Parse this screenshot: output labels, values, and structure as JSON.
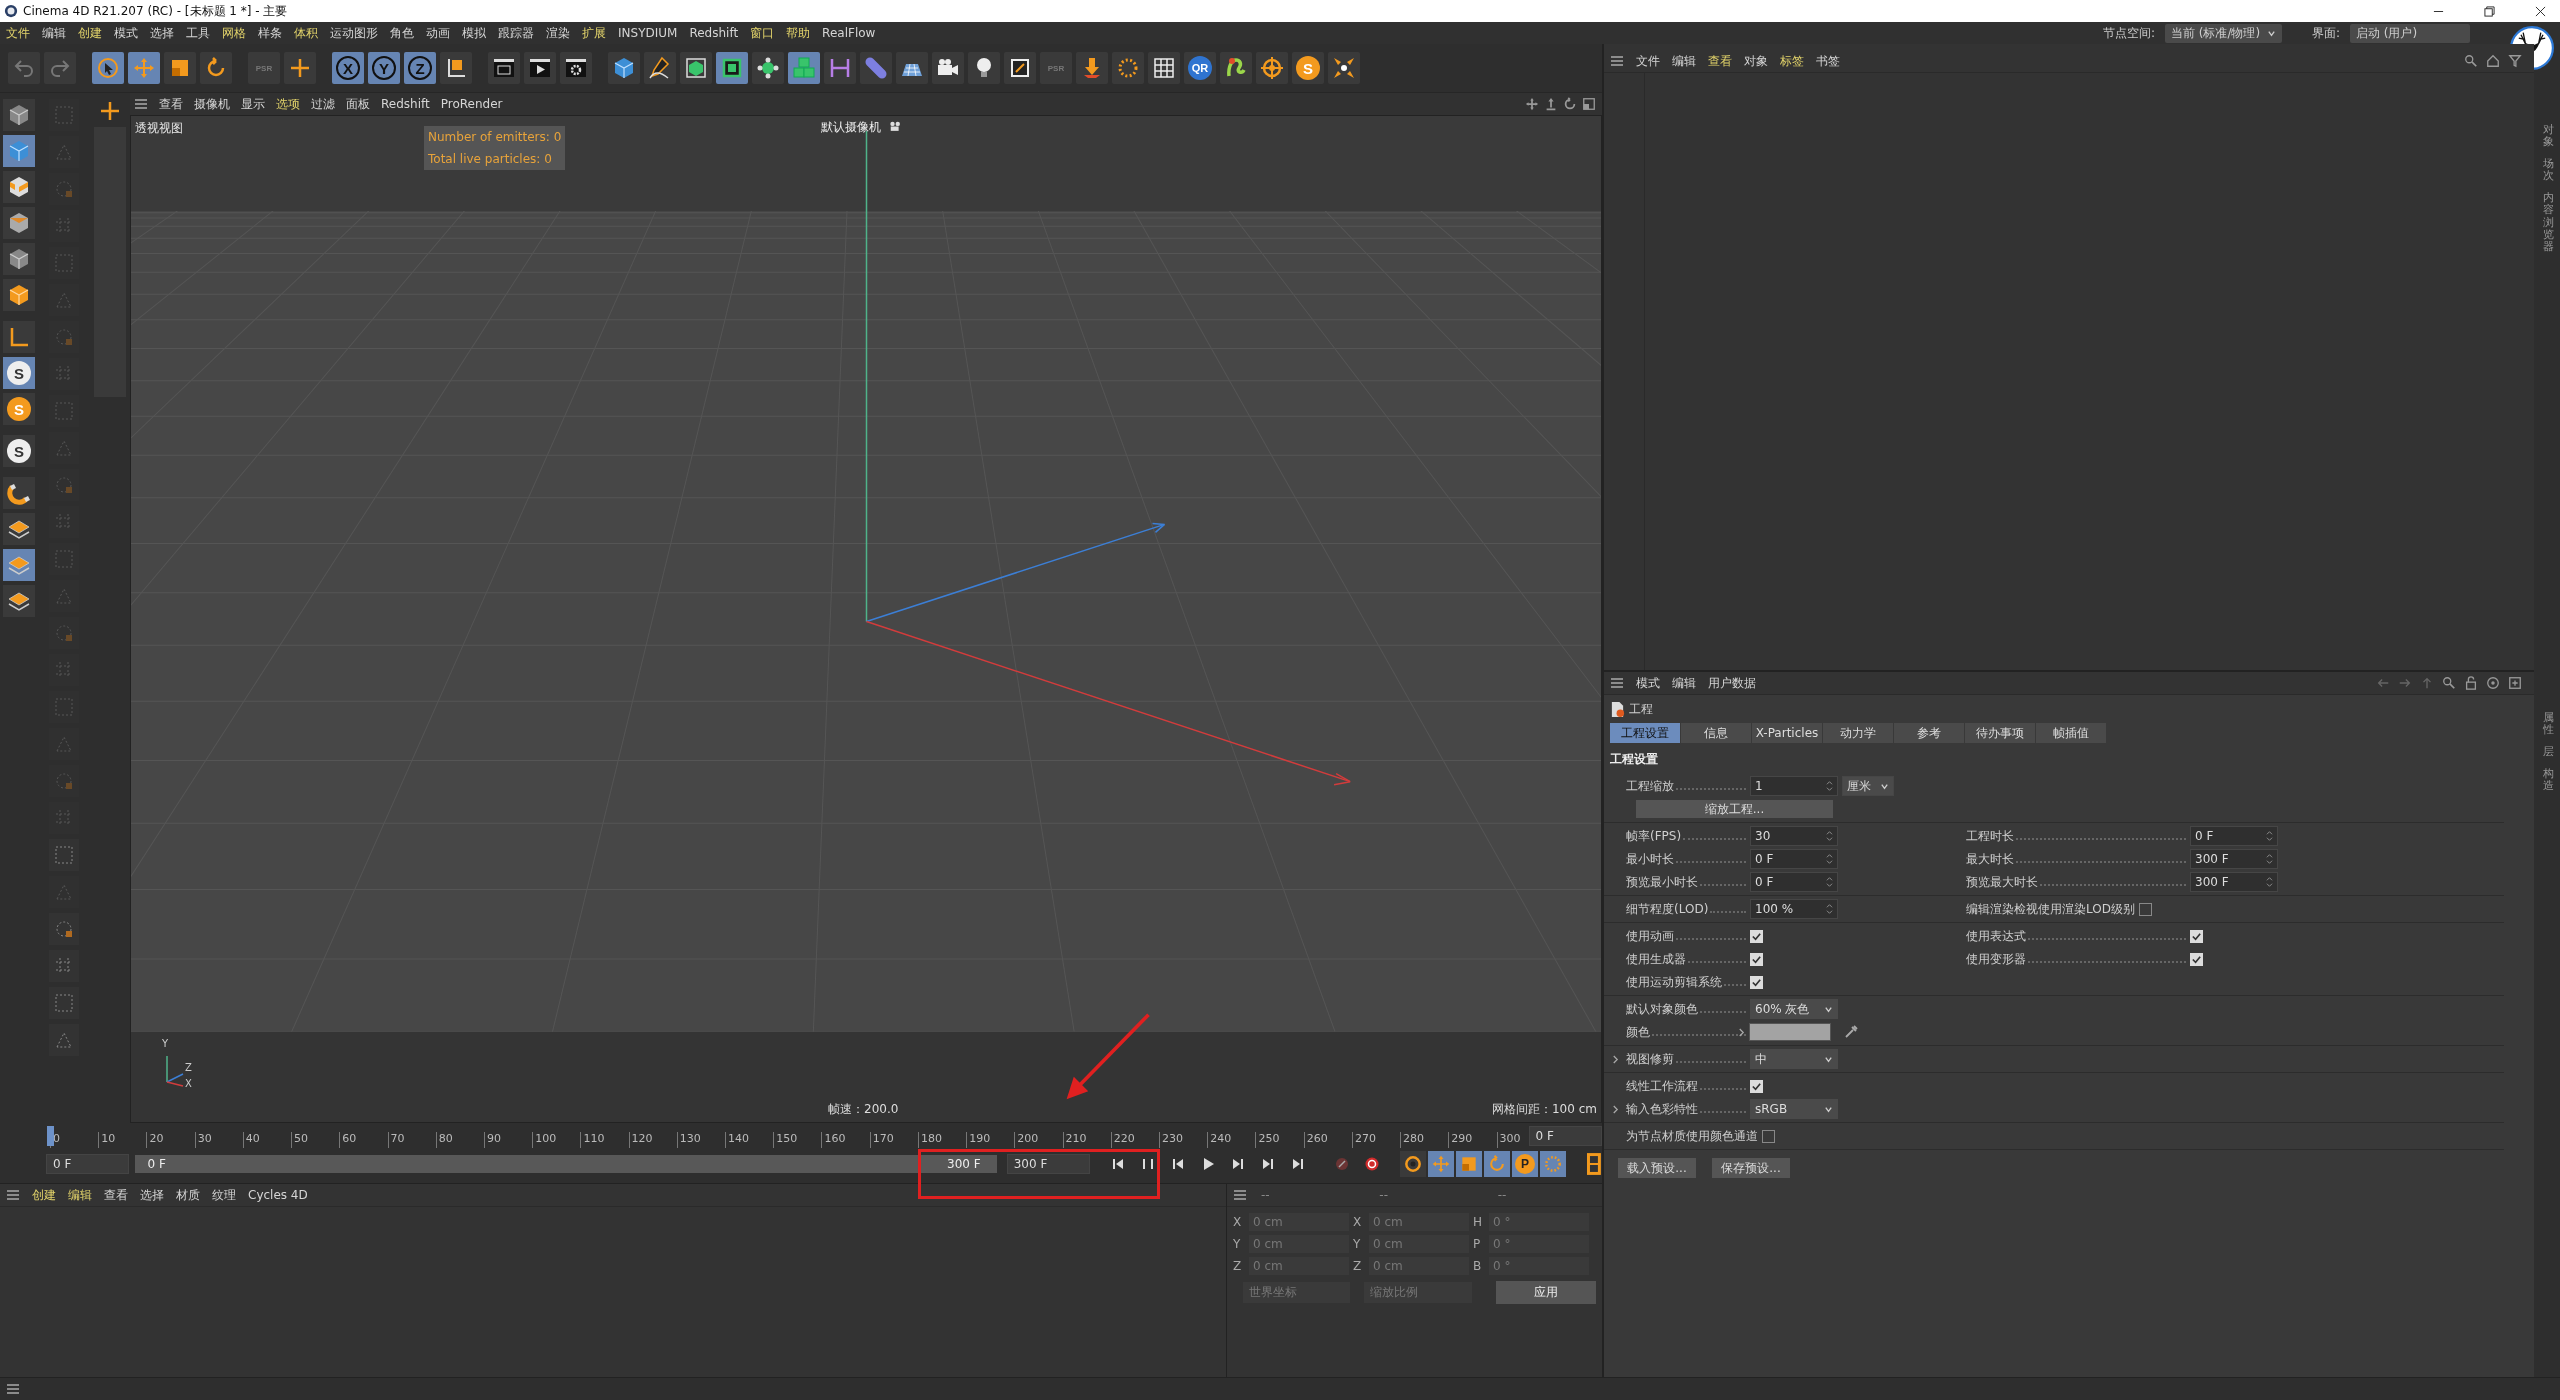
{
  "window": {
    "title": "Cinema 4D R21.207 (RC) - [未标题 1 *] - 主要"
  },
  "menu": [
    {
      "label": "文件",
      "highlighted": true
    },
    {
      "label": "编辑",
      "highlighted": false
    },
    {
      "label": "创建",
      "highlighted": true
    },
    {
      "label": "模式",
      "highlighted": false
    },
    {
      "label": "选择",
      "highlighted": false
    },
    {
      "label": "工具",
      "highlighted": false
    },
    {
      "label": "网格",
      "highlighted": true
    },
    {
      "label": "样条",
      "highlighted": false
    },
    {
      "label": "体积",
      "highlighted": true
    },
    {
      "label": "运动图形",
      "highlighted": false
    },
    {
      "label": "角色",
      "highlighted": false
    },
    {
      "label": "动画",
      "highlighted": false
    },
    {
      "label": "模拟",
      "highlighted": false
    },
    {
      "label": "跟踪器",
      "highlighted": false
    },
    {
      "label": "渲染",
      "highlighted": false
    },
    {
      "label": "扩展",
      "highlighted": true
    },
    {
      "label": "INSYDIUM",
      "highlighted": false
    },
    {
      "label": "Redshift",
      "highlighted": false
    },
    {
      "label": "窗口",
      "highlighted": true
    },
    {
      "label": "帮助",
      "highlighted": true
    },
    {
      "label": "RealFlow",
      "highlighted": false
    }
  ],
  "node_space": {
    "label": "节点空间:",
    "value": "当前 (标准/物理)"
  },
  "layout": {
    "label": "界面:",
    "value": "启动 (用户)"
  },
  "toolbar": [
    {
      "kind": "undo",
      "selected": false
    },
    {
      "kind": "redo",
      "selected": false
    },
    {
      "kind": "select",
      "selected": true
    },
    {
      "kind": "move",
      "selected": true
    },
    {
      "kind": "scale",
      "selected": false
    },
    {
      "kind": "rotate",
      "selected": false
    },
    {
      "kind": "text",
      "label": "PSR",
      "selected": false
    },
    {
      "kind": "add",
      "selected": false
    },
    {
      "kind": "axis",
      "label": "X",
      "selected": true
    },
    {
      "kind": "axis",
      "label": "Y",
      "selected": true
    },
    {
      "kind": "axis",
      "label": "Z",
      "selected": true
    },
    {
      "kind": "coord",
      "selected": false
    },
    {
      "kind": "clapper",
      "selected": false
    },
    {
      "kind": "render",
      "selected": false
    },
    {
      "kind": "settings",
      "selected": false
    },
    {
      "kind": "cube",
      "selected": false
    },
    {
      "kind": "pen",
      "selected": false
    },
    {
      "kind": "cage",
      "selected": false
    },
    {
      "kind": "extrude",
      "selected": true
    },
    {
      "kind": "cluster",
      "selected": false
    },
    {
      "kind": "cubes",
      "selected": true
    },
    {
      "kind": "symmetry",
      "selected": false
    },
    {
      "kind": "pill",
      "selected": false
    },
    {
      "kind": "floor",
      "selected": false
    },
    {
      "kind": "camera",
      "selected": false
    },
    {
      "kind": "bulb",
      "selected": false
    },
    {
      "kind": "tag",
      "selected": false
    },
    {
      "kind": "text",
      "label": "PSR",
      "selected": false
    },
    {
      "kind": "gravity",
      "selected": false
    },
    {
      "kind": "dots",
      "selected": false
    },
    {
      "kind": "grid",
      "selected": false
    },
    {
      "kind": "axis-blue",
      "label": "QR",
      "selected": false
    },
    {
      "kind": "plugin",
      "selected": false
    },
    {
      "kind": "target",
      "selected": false
    },
    {
      "kind": "axis-orange",
      "label": "S",
      "selected": false
    },
    {
      "kind": "explode",
      "selected": false
    }
  ],
  "left_tools": [
    {
      "kind": "cube-grey",
      "selected": false
    },
    {
      "kind": "cube",
      "selected": true
    },
    {
      "kind": "checker",
      "selected": false
    },
    {
      "kind": "poly",
      "selected": false
    },
    {
      "kind": "cube-grey",
      "selected": false
    },
    {
      "kind": "orange-cube",
      "selected": false
    },
    {
      "kind": "corner",
      "selected": false
    },
    {
      "kind": "axis-white",
      "label": "S",
      "selected": true
    },
    {
      "kind": "axis-orange",
      "label": "S",
      "selected": false
    },
    {
      "kind": "axis-white",
      "label": "S",
      "selected": false
    },
    {
      "kind": "magnet",
      "selected": false
    },
    {
      "kind": "layers",
      "selected": false
    },
    {
      "kind": "layers",
      "selected": true
    },
    {
      "kind": "layers",
      "selected": false
    }
  ],
  "secondary_tools": [
    {
      "disabled": true
    },
    {
      "disabled": true
    },
    {
      "disabled": true
    },
    {
      "disabled": true
    },
    {
      "disabled": true
    },
    {
      "disabled": true
    },
    {
      "disabled": true
    },
    {
      "disabled": true
    },
    {
      "disabled": true
    },
    {
      "disabled": true
    },
    {
      "disabled": true
    },
    {
      "disabled": true
    },
    {
      "disabled": true
    },
    {
      "disabled": true
    },
    {
      "disabled": true
    },
    {
      "disabled": true
    },
    {
      "disabled": true
    },
    {
      "disabled": true
    },
    {
      "disabled": true
    },
    {
      "disabled": true
    },
    {
      "disabled": false
    },
    {
      "disabled": true
    },
    {
      "disabled": false
    },
    {
      "disabled": false
    },
    {
      "disabled": false
    },
    {
      "disabled": false
    }
  ],
  "viewport": {
    "menu": [
      {
        "label": "查看",
        "highlighted": false
      },
      {
        "label": "摄像机",
        "highlighted": false
      },
      {
        "label": "显示",
        "highlighted": false
      },
      {
        "label": "选项",
        "highlighted": true
      },
      {
        "label": "过滤",
        "highlighted": false
      },
      {
        "label": "面板",
        "highlighted": false
      },
      {
        "label": "Redshift",
        "highlighted": false
      },
      {
        "label": "ProRender",
        "highlighted": false
      }
    ],
    "view_name": "透视视图",
    "camera": "默认摄像机",
    "overlay": [
      "Number of emitters: 0",
      "Total live particles: 0"
    ],
    "speed": "帧速：200.0",
    "grid_spacing": "网格间距：100 cm",
    "gizmo_labels": [
      "Y",
      "Z",
      "X"
    ]
  },
  "timeline": {
    "ruler": [
      "0",
      "10",
      "20",
      "30",
      "40",
      "50",
      "60",
      "70",
      "80",
      "90",
      "100",
      "110",
      "120",
      "130",
      "140",
      "150",
      "160",
      "170",
      "180",
      "190",
      "200",
      "210",
      "220",
      "230",
      "240",
      "250",
      "260",
      "270",
      "280",
      "290",
      "300"
    ],
    "playhead": {
      "level": 0
    },
    "current": "0 F",
    "start": "0 F",
    "range": {
      "start": "0 F",
      "end": "300 F",
      "level": 1
    },
    "end": "300 F",
    "key_buttons": [
      {
        "kind": "ring",
        "selected": false
      },
      {
        "kind": "move",
        "selected": true
      },
      {
        "kind": "scale",
        "selected": true
      },
      {
        "kind": "rotate",
        "selected": true
      },
      {
        "kind": "text",
        "label": "P",
        "selected": true
      },
      {
        "kind": "dots",
        "selected": true
      }
    ]
  },
  "materials": {
    "menu": [
      {
        "label": "创建",
        "highlighted": true
      },
      {
        "label": "编辑",
        "highlighted": true
      },
      {
        "label": "查看",
        "highlighted": false
      },
      {
        "label": "选择",
        "highlighted": false
      },
      {
        "label": "材质",
        "highlighted": false
      },
      {
        "label": "纹理",
        "highlighted": false
      },
      {
        "label": "Cycles 4D",
        "highlighted": false
      }
    ]
  },
  "coordinates": {
    "headers": [
      "--",
      "--",
      "--"
    ],
    "rows": [
      [
        {
          "axis": "X",
          "value": "0 cm"
        },
        {
          "axis": "X",
          "value": "0 cm"
        },
        {
          "axis": "H",
          "value": "0 °"
        }
      ],
      [
        {
          "axis": "Y",
          "value": "0 cm"
        },
        {
          "axis": "Y",
          "value": "0 cm"
        },
        {
          "axis": "P",
          "value": "0 °"
        }
      ],
      [
        {
          "axis": "Z",
          "value": "0 cm"
        },
        {
          "axis": "Z",
          "value": "0 cm"
        },
        {
          "axis": "B",
          "value": "0 °"
        }
      ]
    ],
    "dropdowns": [
      "世界坐标",
      "缩放比例"
    ],
    "apply": "应用"
  },
  "objects": {
    "menu": [
      {
        "label": "文件",
        "highlighted": false
      },
      {
        "label": "编辑",
        "highlighted": false
      },
      {
        "label": "查看",
        "highlighted": true
      },
      {
        "label": "对象",
        "highlighted": false
      },
      {
        "label": "标签",
        "highlighted": true
      },
      {
        "label": "书签",
        "highlighted": false
      }
    ],
    "side_tabs": [
      "对象",
      "场次",
      "内容浏览器"
    ]
  },
  "attributes": {
    "menu": [
      "模式",
      "编辑",
      "用户数据"
    ],
    "title": "工程",
    "side_tabs": [
      "属性",
      "层",
      "构造"
    ],
    "tabs": [
      {
        "label": "工程设置",
        "selected": true
      },
      {
        "label": "信息",
        "selected": false
      },
      {
        "label": "X-Particles",
        "selected": false
      },
      {
        "label": "动力学",
        "selected": false
      },
      {
        "label": "参考",
        "selected": false
      },
      {
        "label": "待办事项",
        "selected": false
      },
      {
        "label": "帧插值",
        "selected": false
      }
    ],
    "section": "工程设置",
    "groups": [
      [
        {
          "expandable": false,
          "cells": [
            {
              "kind": "number",
              "label": "工程缩放",
              "value": "1",
              "unit": "厘米"
            }
          ]
        },
        {
          "expandable": false,
          "cells": [
            {
              "kind": "button",
              "label": "缩放工程..."
            }
          ]
        }
      ],
      [
        {
          "expandable": false,
          "cells": [
            {
              "kind": "number",
              "label": "帧率(FPS)",
              "value": "30"
            },
            {
              "kind": "number",
              "label": "工程时长",
              "value": "0 F"
            }
          ]
        },
        {
          "expandable": false,
          "cells": [
            {
              "kind": "number",
              "label": "最小时长",
              "value": "0 F"
            },
            {
              "kind": "number",
              "label": "最大时长",
              "value": "300 F"
            }
          ]
        },
        {
          "expandable": false,
          "cells": [
            {
              "kind": "number",
              "label": "预览最小时长",
              "value": "0 F"
            },
            {
              "kind": "number",
              "label": "预览最大时长",
              "value": "300 F"
            }
          ]
        }
      ],
      [
        {
          "expandable": false,
          "cells": [
            {
              "kind": "number",
              "label": "细节程度(LOD)",
              "value": "100 %"
            },
            {
              "kind": "checkbox",
              "label": "编辑渲染检视使用渲染LOD级别",
              "checked": false,
              "leader": false
            }
          ]
        }
      ],
      [
        {
          "expandable": false,
          "cells": [
            {
              "kind": "checkbox",
              "label": "使用动画",
              "checked": true,
              "leader": true
            },
            {
              "kind": "checkbox",
              "label": "使用表达式",
              "checked": true,
              "leader": true
            }
          ]
        },
        {
          "expandable": false,
          "cells": [
            {
              "kind": "checkbox",
              "label": "使用生成器",
              "checked": true,
              "leader": true
            },
            {
              "kind": "checkbox",
              "label": "使用变形器",
              "checked": true,
              "leader": true
            }
          ]
        },
        {
          "expandable": false,
          "cells": [
            {
              "kind": "checkbox",
              "label": "使用运动剪辑系统",
              "checked": true,
              "leader": true
            }
          ]
        }
      ],
      [
        {
          "expandable": false,
          "cells": [
            {
              "kind": "dropdown",
              "label": "默认对象颜色",
              "value": "60% 灰色"
            }
          ]
        },
        {
          "expandable": false,
          "cells": [
            {
              "kind": "color",
              "label": "颜色",
              "color": "#a3a3a3"
            }
          ]
        }
      ],
      [
        {
          "expandable": true,
          "cells": [
            {
              "kind": "dropdown",
              "label": "视图修剪",
              "value": "中"
            }
          ]
        }
      ],
      [
        {
          "expandable": false,
          "cells": [
            {
              "kind": "checkbox",
              "label": "线性工作流程",
              "checked": true,
              "leader": true
            }
          ]
        },
        {
          "expandable": true,
          "cells": [
            {
              "kind": "dropdown",
              "label": "输入色彩特性",
              "value": "sRGB"
            }
          ]
        }
      ],
      [
        {
          "expandable": false,
          "cells": [
            {
              "kind": "checkbox",
              "label": "为节点材质使用颜色通道",
              "checked": false,
              "leader": false
            }
          ]
        }
      ]
    ],
    "buttons": [
      "载入预设...",
      "保存预设..."
    ]
  }
}
